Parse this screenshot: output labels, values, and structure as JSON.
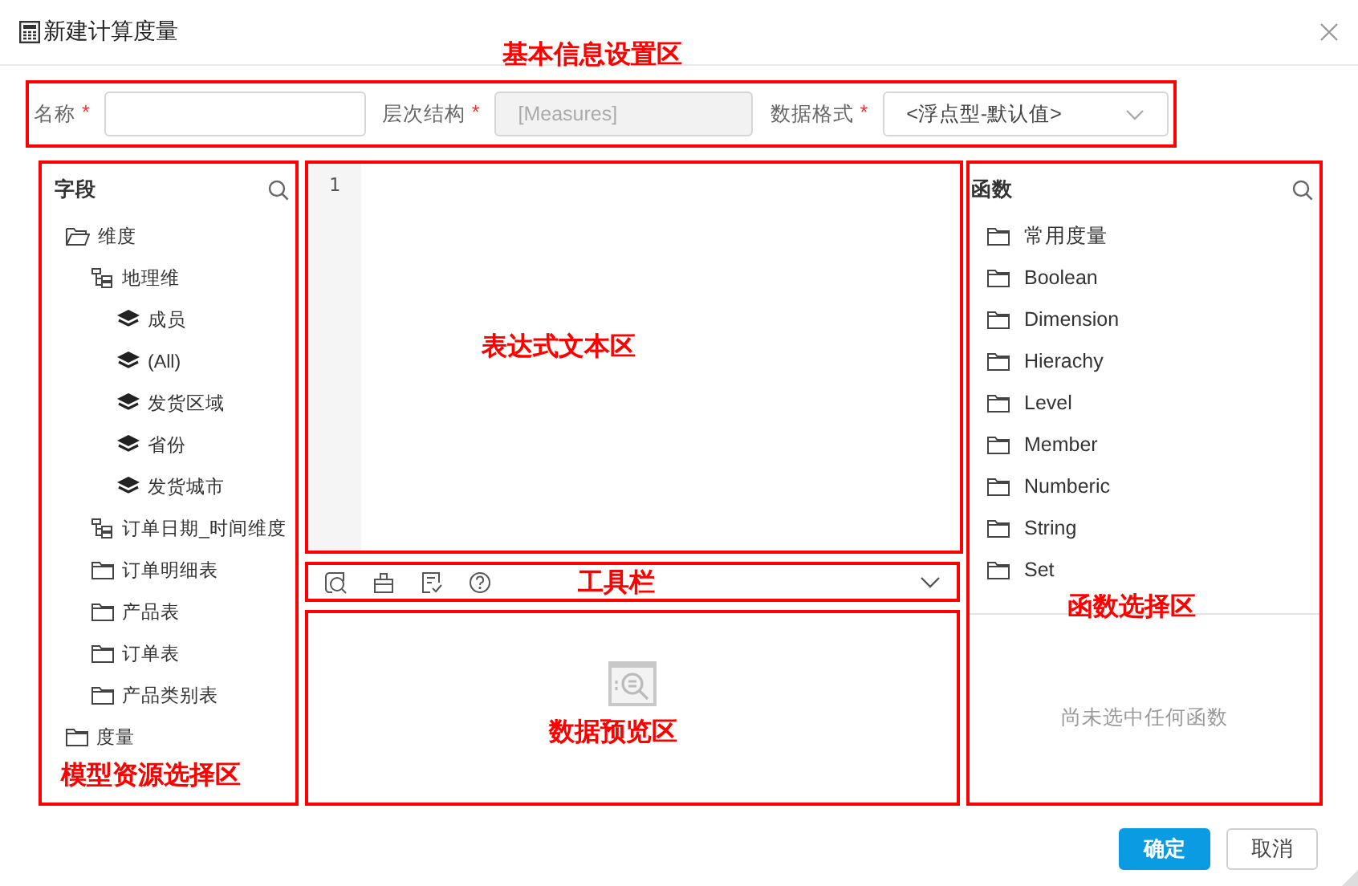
{
  "window": {
    "title": "新建计算度量"
  },
  "form": {
    "annotation": "基本信息设置区",
    "fields": [
      {
        "kind": "text",
        "label": "名称",
        "required_mark": "*",
        "disabled": false
      },
      {
        "kind": "text",
        "label": "层次结构",
        "required_mark": "*",
        "disabled": true,
        "value": "[Measures]"
      },
      {
        "kind": "select",
        "label": "数据格式",
        "required_mark": "*",
        "disabled": false,
        "value": "<浮点型-默认值>"
      }
    ]
  },
  "fields_panel": {
    "title": "字段",
    "annotation": "模型资源选择区",
    "tree": [
      {
        "kind": "open-folder",
        "label": "维度",
        "children": [
          {
            "kind": "hierarchy",
            "label": "地理维",
            "children": [
              {
                "kind": "level",
                "label": "成员"
              },
              {
                "kind": "level",
                "label": "(All)"
              },
              {
                "kind": "level",
                "label": "发货区域"
              },
              {
                "kind": "level",
                "label": "省份"
              },
              {
                "kind": "level",
                "label": "发货城市"
              }
            ]
          },
          {
            "kind": "hierarchy",
            "label": "订单日期_时间维度"
          },
          {
            "kind": "folder",
            "label": "订单明细表"
          },
          {
            "kind": "folder",
            "label": "产品表"
          },
          {
            "kind": "folder",
            "label": "订单表"
          },
          {
            "kind": "folder",
            "label": "产品类别表"
          }
        ]
      },
      {
        "kind": "folder",
        "label": "度量"
      }
    ]
  },
  "editor": {
    "annotation": "表达式文本区",
    "line_numbers": [
      "1"
    ]
  },
  "toolbar": {
    "annotation": "工具栏"
  },
  "preview": {
    "annotation": "数据预览区"
  },
  "functions_panel": {
    "title": "函数",
    "annotation": "函数选择区",
    "items": [
      "常用度量",
      "Boolean",
      "Dimension",
      "Hierachy",
      "Level",
      "Member",
      "Numberic",
      "String",
      "Set"
    ],
    "empty_text": "尚未选中任何函数"
  },
  "buttons": [
    {
      "label": "确定",
      "kind": "primary"
    },
    {
      "label": "取消",
      "kind": "default"
    }
  ]
}
